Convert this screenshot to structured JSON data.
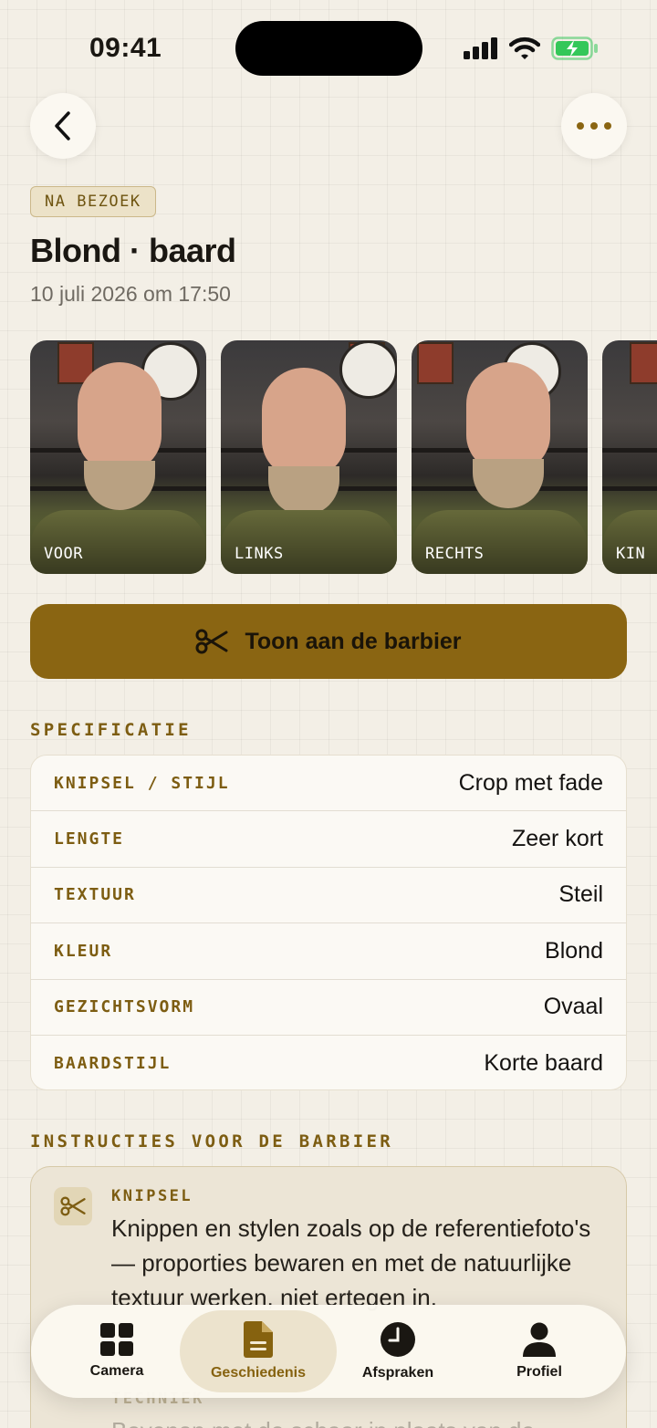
{
  "status_bar": {
    "time": "09:41"
  },
  "header": {
    "badge": "NA BEZOEK",
    "title": "Blond · baard",
    "subtitle": "10 juli 2026 om 17:50"
  },
  "photos": [
    {
      "label": "VOOR"
    },
    {
      "label": "LINKS"
    },
    {
      "label": "RECHTS"
    },
    {
      "label": "KIN"
    }
  ],
  "cta": {
    "label": "Toon aan de barbier"
  },
  "spec": {
    "title": "SPECIFICATIE",
    "rows": [
      {
        "key": "KNIPSEL / STIJL",
        "value": "Crop met fade"
      },
      {
        "key": "LENGTE",
        "value": "Zeer kort"
      },
      {
        "key": "TEXTUUR",
        "value": "Steil"
      },
      {
        "key": "KLEUR",
        "value": "Blond"
      },
      {
        "key": "GEZICHTSVORM",
        "value": "Ovaal"
      },
      {
        "key": "BAARDSTIJL",
        "value": "Korte baard"
      }
    ]
  },
  "instructions": {
    "title": "INSTRUCTIES VOOR DE BARBIER",
    "items": [
      {
        "label": "KNIPSEL",
        "text": "Knippen en stylen zoals op de referentiefoto's — proporties bewaren en met de natuurlijke textuur werken, niet ertegen in."
      },
      {
        "label": "TECHNIEK",
        "text": "Bovenop met de schaar in plaats van de tondeuse."
      }
    ]
  },
  "tabbar": {
    "tabs": [
      {
        "label": "Camera",
        "icon": "grid-icon"
      },
      {
        "label": "Geschiedenis",
        "icon": "document-icon",
        "active": true
      },
      {
        "label": "Afspraken",
        "icon": "clock-icon"
      },
      {
        "label": "Profiel",
        "icon": "person-icon"
      }
    ]
  },
  "colors": {
    "accent": "#8a6512",
    "background": "#f3efe6",
    "label": "#7d5d12"
  }
}
